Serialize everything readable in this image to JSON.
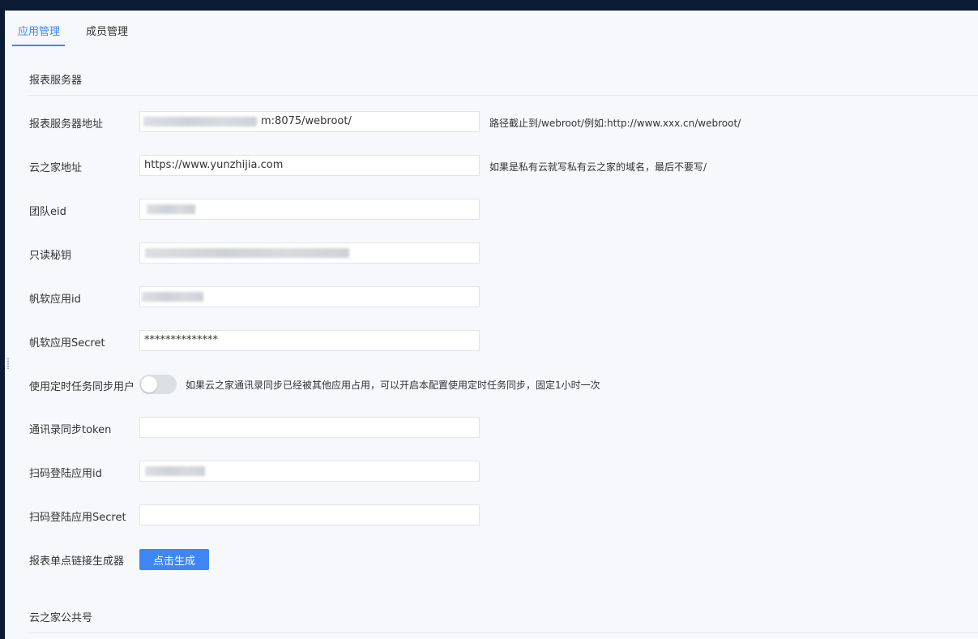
{
  "tabs": [
    {
      "label": "应用管理",
      "active": true
    },
    {
      "label": "成员管理",
      "active": false
    }
  ],
  "sections": {
    "report_server": "报表服务器",
    "public_account": "云之家公共号"
  },
  "fields": {
    "server_address": {
      "label": "报表服务器地址",
      "value": "m:8075/webroot/",
      "hint": "路径截止到/webroot/例如:http://www.xxx.cn/webroot/"
    },
    "yzj_address": {
      "label": "云之家地址",
      "value": "https://www.yunzhijia.com",
      "hint": "如果是私有云就写私有云之家的域名，最后不要写/"
    },
    "team_eid": {
      "label": "团队eid",
      "value": ""
    },
    "readonly_secret": {
      "label": "只读秘钥",
      "value": ""
    },
    "fanruan_app_id": {
      "label": "帆软应用id",
      "value": ""
    },
    "fanruan_app_secret": {
      "label": "帆软应用Secret",
      "value": "**************"
    },
    "sync_users": {
      "label": "使用定时任务同步用户",
      "enabled": false,
      "hint": "如果云之家通讯录同步已经被其他应用占用，可以开启本配置使用定时任务同步，固定1小时一次"
    },
    "contacts_token": {
      "label": "通讯录同步token",
      "value": ""
    },
    "scan_login_app_id": {
      "label": "扫码登陆应用id",
      "value": ""
    },
    "scan_login_app_secret": {
      "label": "扫码登陆应用Secret",
      "value": ""
    },
    "sso_generator": {
      "label": "报表单点链接生成器",
      "button": "点击生成"
    }
  },
  "colors": {
    "accent": "#3e86f5",
    "background": "#f6f8fb",
    "outer": "#0c1a33"
  }
}
